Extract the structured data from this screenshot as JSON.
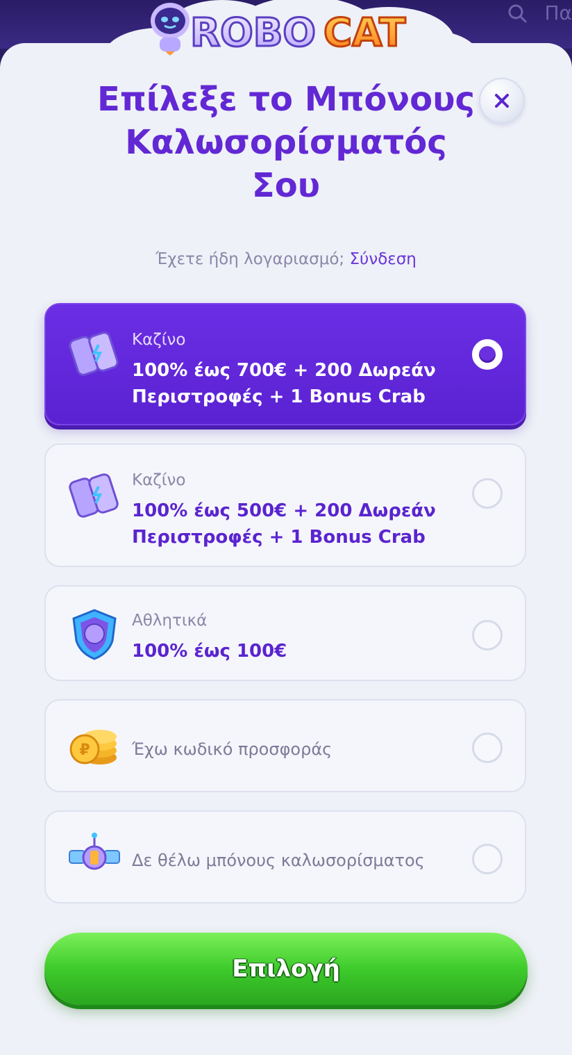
{
  "topbar": {
    "search_text": "Πα"
  },
  "brand": {
    "logo_text": "ROBOCAT"
  },
  "modal": {
    "title_line1": "Επίλεξε το Μπόνους",
    "title_line2": "Καλωσορίσματός",
    "title_line3": "Σου",
    "login_prompt": "Έχετε ήδη λογαριασμό;",
    "login_link": "Σύνδεση",
    "close_label": "×"
  },
  "options": [
    {
      "category": "Καζίνο",
      "line1": "100% έως 700€ + 200 Δωρεάν",
      "line2": "Περιστροφές + 1 Bonus Crab",
      "icon": "battery-icon",
      "selected": true
    },
    {
      "category": "Καζίνο",
      "line1": "100% έως 500€ + 200 Δωρεάν",
      "line2": "Περιστροφές + 1 Bonus Crab",
      "icon": "battery-icon",
      "selected": false
    },
    {
      "category": "Αθλητικά",
      "line1": "100% έως 100€",
      "icon": "shield-ball-icon",
      "selected": false
    },
    {
      "label": "Έχω κωδικό προσφοράς",
      "icon": "coins-icon",
      "selected": false
    },
    {
      "label": "Δε θέλω μπόνους καλωσορίσματος",
      "icon": "satellite-icon",
      "selected": false
    }
  ],
  "cta": {
    "label": "Επιλογή"
  },
  "colors": {
    "accent": "#6228d4",
    "selected_bg": "#5f27d8",
    "cta_green": "#3ecb2b"
  }
}
